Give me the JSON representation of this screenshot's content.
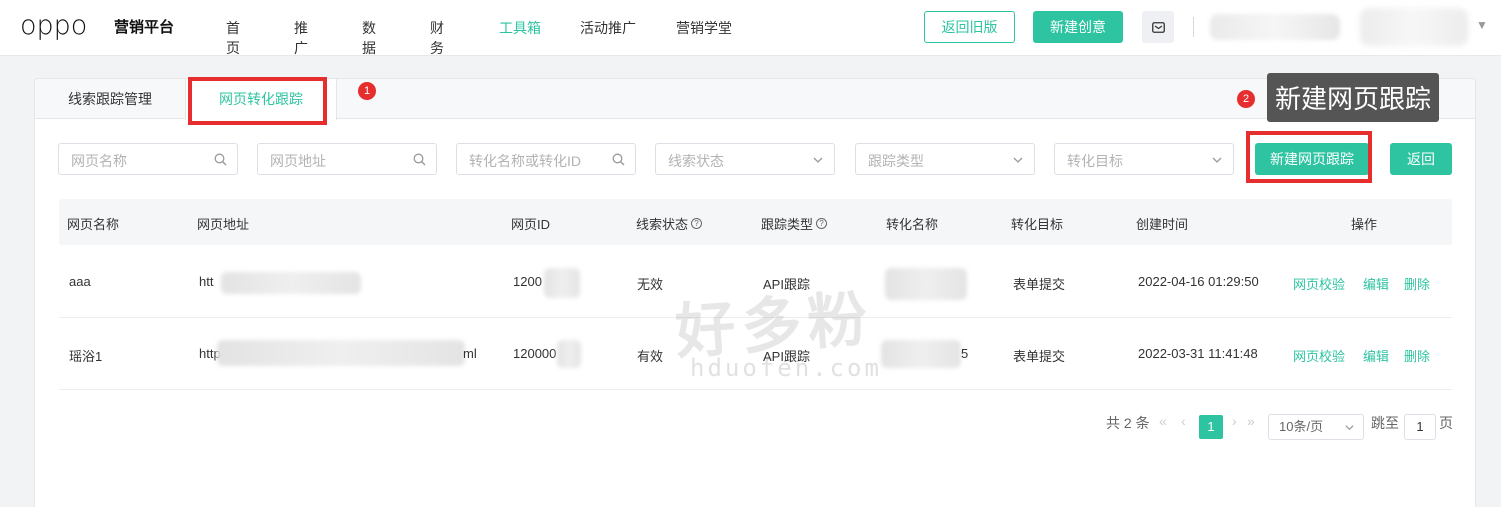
{
  "header": {
    "logo": "oppo",
    "brand": "营销平台",
    "nav": [
      "首页",
      "推广",
      "数据",
      "财务",
      "工具箱",
      "活动推广",
      "营销学堂"
    ],
    "active_nav": "工具箱",
    "old_version_label": "返回旧版",
    "new_creative_label": "新建创意",
    "mail_icon": "mail-icon",
    "account_caret": "▼"
  },
  "tabs": {
    "tab1": "线索跟踪管理",
    "tab2": "网页转化跟踪",
    "badge1": "1",
    "badge2": "2",
    "tooltip": "新建网页跟踪"
  },
  "filters": {
    "page_name": "网页名称",
    "page_url": "网页地址",
    "conversion": "转化名称或转化ID",
    "lead_status": "线索状态",
    "track_type": "跟踪类型",
    "conv_target": "转化目标",
    "new_page_btn": "新建网页跟踪",
    "back_btn": "返回"
  },
  "table": {
    "columns": [
      "网页名称",
      "网页地址",
      "网页ID",
      "线索状态",
      "跟踪类型",
      "转化名称",
      "转化目标",
      "创建时间",
      "操作"
    ],
    "rows": [
      {
        "name": "aaa",
        "url": "htt",
        "id": "1200",
        "status": "无效",
        "type": "API跟踪",
        "conv_name": "",
        "target": "表单提交",
        "created": "2022-04-16 01:29:50",
        "ops": [
          "网页校验",
          "编辑",
          "删除"
        ]
      },
      {
        "name": "瑶浴1",
        "url": "http",
        "url_tail": "ml",
        "id": "120000",
        "status": "有效",
        "type": "API跟踪",
        "conv_name": "",
        "conv_tail": "5",
        "target": "表单提交",
        "created": "2022-03-31 11:41:48",
        "ops": [
          "网页校验",
          "编辑",
          "删除"
        ]
      }
    ]
  },
  "pagination": {
    "total": "共 2 条",
    "current": "1",
    "page_size": "10条/页",
    "jump_label": "跳至",
    "jump_value": "1",
    "page_suffix": "页"
  },
  "watermark": {
    "text": "好多粉",
    "url": "hduofen.com"
  },
  "colors": {
    "accent": "#2ec4a1",
    "highlight": "#e62e2e"
  }
}
